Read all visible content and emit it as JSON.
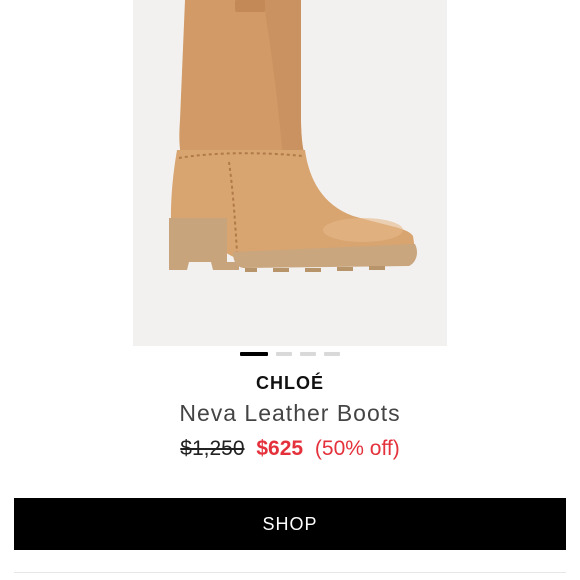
{
  "product": {
    "brand": "CHLOÉ",
    "name": "Neva Leather Boots",
    "price_original": "$1,250",
    "price_sale": "$625",
    "discount": "(50% off)"
  },
  "image": {
    "total_slides": 4,
    "active_slide": 1
  },
  "actions": {
    "shop_label": "SHOP"
  },
  "colors": {
    "sale": "#e4313b",
    "button_bg": "#000000",
    "leather": "#d7a06d",
    "sole": "#c9a67e"
  }
}
